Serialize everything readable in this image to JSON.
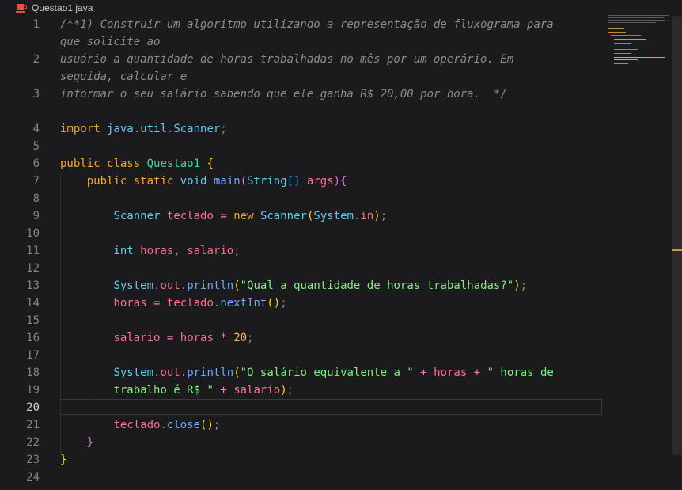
{
  "tab": {
    "filename": "Questao1.java",
    "icon": "java-file-icon"
  },
  "active_line": "20",
  "line_numbers": [
    "1",
    "2",
    "3",
    "4",
    "5",
    "6",
    "7",
    "8",
    "9",
    "10",
    "11",
    "12",
    "13",
    "14",
    "15",
    "16",
    "17",
    "18",
    "19",
    "20",
    "21",
    "22",
    "23",
    "24"
  ],
  "code": {
    "l1": "/**1) Construir um algoritmo utilizando a representação de fluxograma para",
    "l1b": "que solicite ao",
    "l2": "usuário a quantidade de horas trabalhadas no mês por um operário. Em",
    "l2b": "seguida, calcular e",
    "l3": "informar o seu salário sabendo que ele ganha R$ 20,00 por hora.  */",
    "import_kw": "import",
    "import_pkg": "java",
    "import_pkg2": "util",
    "import_cls": "Scanner",
    "public": "public",
    "class": "class",
    "class_name": "Questao1",
    "static": "static",
    "void": "void",
    "main": "main",
    "string_type": "String",
    "args": "args",
    "scanner_type": "Scanner",
    "teclado": "teclado",
    "new": "new",
    "system": "System",
    "in": "in",
    "int": "int",
    "horas": "horas",
    "salario": "salario",
    "out": "out",
    "println": "println",
    "str1": "\"Qual a quantidade de horas trabalhadas?\"",
    "nextInt": "nextInt",
    "twenty": "20",
    "str2": "\"O salário equivalente a \"",
    "str3": "\" horas de",
    "str3b": "trabalho é R$ \"",
    "close": "close"
  }
}
